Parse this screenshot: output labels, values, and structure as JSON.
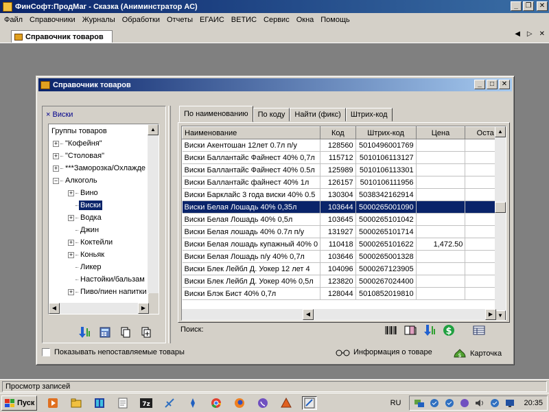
{
  "app": {
    "title": "ФинСофт:ПродМаг - Сказка   (Аниминстратор АС)",
    "window_buttons": [
      "_",
      "❐",
      "✕"
    ]
  },
  "menu": [
    "Файл",
    "Справочники",
    "Журналы",
    "Обработки",
    "Отчеты",
    "ЕГАИС",
    "ВЕТИС",
    "Сервис",
    "Окна",
    "Помощь"
  ],
  "doc_tab": {
    "label": "Справочник товаров"
  },
  "child": {
    "title": "Справочник товаров",
    "filter_label": "× Виски",
    "tree": [
      {
        "label": "Группы товаров",
        "level": 0,
        "box": ""
      },
      {
        "label": "\"Кофейня\"",
        "level": 1,
        "box": "+"
      },
      {
        "label": "\"Столовая\"",
        "level": 1,
        "box": "+"
      },
      {
        "label": "***Заморозка/Охлажде",
        "level": 1,
        "box": "+"
      },
      {
        "label": "Алкоголь",
        "level": 1,
        "box": "−"
      },
      {
        "label": "Вино",
        "level": 2,
        "box": "+"
      },
      {
        "label": "Виски",
        "level": 2,
        "box": "",
        "selected": true
      },
      {
        "label": "Водка",
        "level": 2,
        "box": "+"
      },
      {
        "label": "Джин",
        "level": 2,
        "box": ""
      },
      {
        "label": "Коктейли",
        "level": 2,
        "box": "+"
      },
      {
        "label": "Коньяк",
        "level": 2,
        "box": "+"
      },
      {
        "label": "Ликер",
        "level": 2,
        "box": ""
      },
      {
        "label": "Настойки/бальзам",
        "level": 2,
        "box": ""
      },
      {
        "label": "Пиво/пиен напитки",
        "level": 2,
        "box": "+"
      }
    ],
    "tabs": [
      "По наименованию",
      "По коду",
      "Найти (фикс)",
      "Штрих-код"
    ],
    "columns": [
      "Наименование",
      "Код",
      "Штрих-код",
      "Цена",
      "Оста"
    ],
    "rows": [
      {
        "name": "Виски Акентошан 12лет 0.7л п/у",
        "code": "128560",
        "barcode": "5010496001769",
        "price": ""
      },
      {
        "name": "Виски Баллантайс Файнест 40% 0,7л",
        "code": "115712",
        "barcode": "5010106113127",
        "price": ""
      },
      {
        "name": "Виски Баллантайс Файнест 40% 0.5л",
        "code": "125989",
        "barcode": "5010106113301",
        "price": ""
      },
      {
        "name": "Виски Баллантайс файнест 40% 1л",
        "code": "126157",
        "barcode": "5010106111956",
        "price": ""
      },
      {
        "name": "Виски Барклайс 3 года виски 40% 0.5",
        "code": "130304",
        "barcode": "5038342162914",
        "price": ""
      },
      {
        "name": "Виски Белая Лошадь 40% 0,35л",
        "code": "103644",
        "barcode": "5000265001090",
        "price": "",
        "selected": true
      },
      {
        "name": "Виски Белая Лошадь 40% 0,5л",
        "code": "103645",
        "barcode": "5000265101042",
        "price": ""
      },
      {
        "name": "Виски Белая лошадь 40% 0.7л п/у",
        "code": "131927",
        "barcode": "5000265101714",
        "price": ""
      },
      {
        "name": "Виски Белая лошадь купажный 40% 0",
        "code": "110418",
        "barcode": "5000265101622",
        "price": "1,472.50"
      },
      {
        "name": "Виски Белая Лошадь п/у 40% 0,7л",
        "code": "103646",
        "barcode": "5000265001328",
        "price": ""
      },
      {
        "name": "Виски Блек Лейбл Д. Уокер 12 лет 4",
        "code": "104096",
        "barcode": "5000267123905",
        "price": ""
      },
      {
        "name": "Виски Блек Лейбл Д. Уокер 40% 0,5л",
        "code": "123820",
        "barcode": "5000267024400",
        "price": ""
      },
      {
        "name": "Виски Блэк Бист 40% 0,7л",
        "code": "128044",
        "barcode": "5010852019810",
        "price": ""
      }
    ],
    "search_label": "Поиск:",
    "show_unsupplied": "Показывать непоставляемые товары",
    "info_label": "Информация о товаре",
    "card_label": "Карточка"
  },
  "status": {
    "text": "Просмотр записей"
  },
  "taskbar": {
    "start": "Пуск",
    "lang": "RU",
    "clock": "20:35"
  },
  "colors": {
    "titlebar": "#0a246a",
    "selection": "#0a246a",
    "face": "#d4d0c8",
    "mdi_bg": "#808080"
  }
}
